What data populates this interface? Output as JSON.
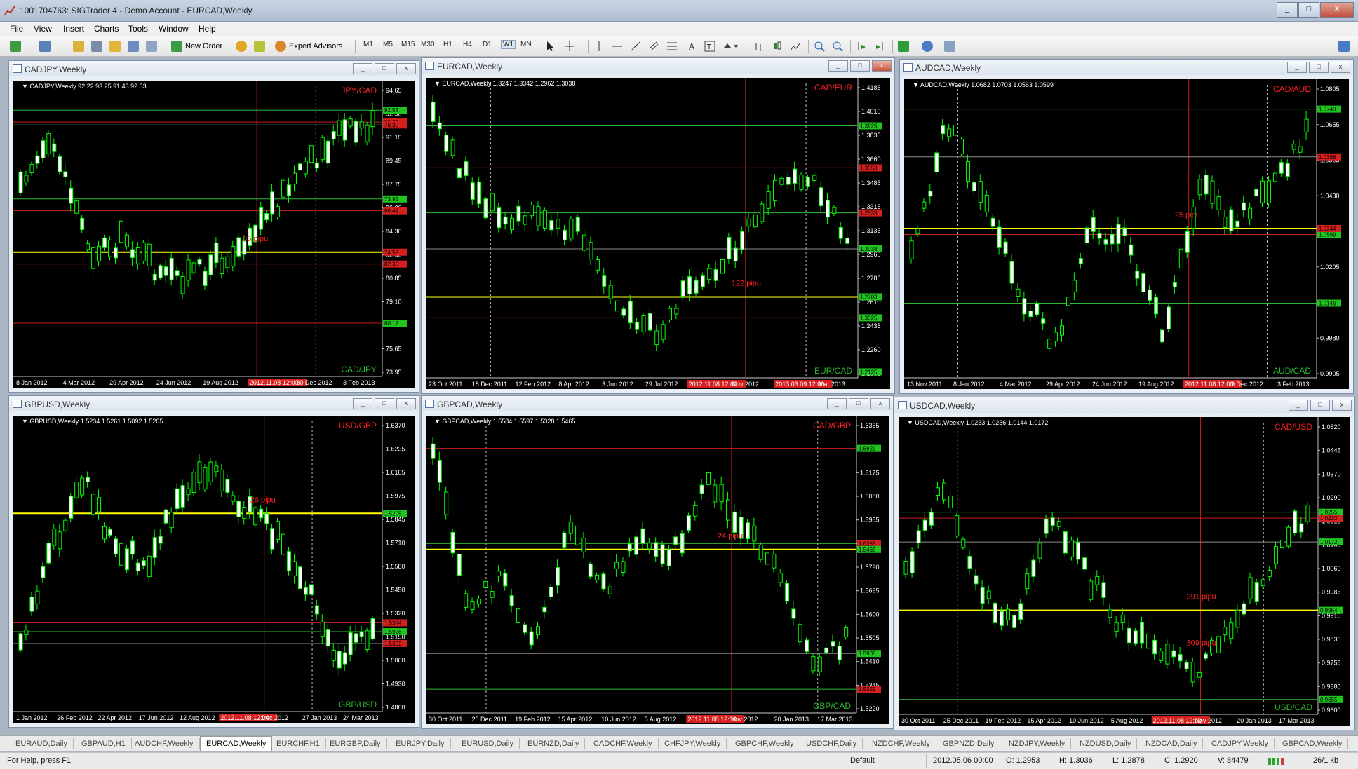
{
  "window": {
    "title": "1001704763: SIGTrader 4 - Demo Account - EURCAD,Weekly",
    "min": "_",
    "max": "□",
    "close": "X"
  },
  "menu": [
    "File",
    "View",
    "Insert",
    "Charts",
    "Tools",
    "Window",
    "Help"
  ],
  "toolbar": {
    "new_order": "New Order",
    "expert_advisors": "Expert Advisors",
    "timeframes": [
      "M1",
      "M5",
      "M15",
      "M30",
      "H1",
      "H4",
      "D1",
      "W1",
      "MN"
    ],
    "active_timeframe": "W1"
  },
  "charts": [
    {
      "window_title": "CADJPY,Weekly",
      "info": "CADJPY,Weekly  92.22 93.25 91.43 92.53",
      "label_top": "JPY/CAD",
      "label_bottom": "CAD/JPY",
      "pips": "35 pipu",
      "y_ticks": [
        "94.65",
        "92.90",
        "91.15",
        "89.45",
        "87.75",
        "86.00",
        "84.30",
        "82.60",
        "80.85",
        "79.10",
        "77.40",
        "75.65",
        "73.95"
      ],
      "x_ticks": [
        "8 Jan 2012",
        "4 Mar 2012",
        "29 Apr 2012",
        "24 Jun 2012",
        "19 Aug 2012",
        "2012.11.08 12:00",
        "30 Dec 2012",
        "3 Feb 2013"
      ],
      "price_tags": [
        "92.53",
        "90.30",
        "86.42",
        "82.30",
        "80.17",
        "78.35",
        "74.52",
        "73.95"
      ]
    },
    {
      "window_title": "EURCAD,Weekly",
      "info": "EURCAD,Weekly  1.3247 1.3342 1.2962 1.3038",
      "label_top": "CAD/EUR",
      "label_bottom": "EUR/CAD",
      "pips": "122 pipu",
      "y_ticks": [
        "1.4185",
        "1.4010",
        "1.3835",
        "1.3660",
        "1.3485",
        "1.3315",
        "1.3135",
        "1.2960",
        "1.2785",
        "1.2610",
        "1.2435",
        "1.2260",
        "1.2085"
      ],
      "x_ticks": [
        "23 Oct 2011",
        "18 Dec 2011",
        "12 Feb 2012",
        "8 Apr 2012",
        "3 Jun 2012",
        "29 Jul 2012",
        "2012.11.08 12:00",
        "Nov 2012",
        "2013.03.09 12:00",
        "Mar 2013"
      ],
      "price_tags": [
        "1.3925",
        "1.3553",
        "1.3325",
        "1.3038",
        "1.2703",
        "1.2533",
        "1.2125"
      ]
    },
    {
      "window_title": "AUDCAD,Weekly",
      "info": "AUDCAD,Weekly  1.0682 1.0703 1.0563 1.0599",
      "label_top": "CAD/AUD",
      "label_bottom": "AUD/CAD",
      "pips": "25 pipu",
      "y_ticks": [
        "1.0805",
        "1.0655",
        "1.0505",
        "1.0430",
        "1.0280",
        "1.0205",
        "1.0055",
        "0.9980",
        "0.9905"
      ],
      "x_ticks": [
        "13 Nov 2011",
        "8 Jan 2012",
        "4 Mar 2012",
        "29 Apr 2012",
        "24 Jun 2012",
        "19 Aug 2012",
        "2012.11.08 12:00",
        "9 Dec 2012",
        "3 Feb 2013"
      ],
      "price_tags": [
        "1.0748",
        "1.0599",
        "1.0368",
        "1.0344",
        "1.0146"
      ]
    },
    {
      "window_title": "GBPUSD,Weekly",
      "info": "GBPUSD,Weekly  1.5234 1.5261 1.5092 1.5205",
      "label_top": "USD/GBP",
      "label_bottom": "GBP/USD",
      "pips": "26 pipu",
      "y_ticks": [
        "1.6370",
        "1.6235",
        "1.6105",
        "1.5975",
        "1.5845",
        "1.5710",
        "1.5580",
        "1.5450",
        "1.5320",
        "1.5190",
        "1.5060",
        "1.4930",
        "1.4800"
      ],
      "x_ticks": [
        "1 Jan 2012",
        "26 Feb 2012",
        "22 Apr 2012",
        "17 Jun 2012",
        "12 Aug 2012",
        "2012.11.08 12:00",
        "Dec 2012",
        "27 Jan 2013",
        "24 Mar 2013"
      ],
      "price_tags": [
        "1.5928",
        "1.5324",
        "1.5302",
        "1.5205"
      ]
    },
    {
      "window_title": "GBPCAD,Weekly",
      "info": "GBPCAD,Weekly  1.5584 1.5597 1.5328 1.5465",
      "label_top": "CAD/GBP",
      "label_bottom": "GBP/CAD",
      "pips": "24 pipu",
      "y_ticks": [
        "1.6365",
        "1.6265",
        "1.6175",
        "1.6080",
        "1.5985",
        "1.5890",
        "1.5790",
        "1.5695",
        "1.5600",
        "1.5505",
        "1.5410",
        "1.5315",
        "1.5220"
      ],
      "x_ticks": [
        "30 Oct 2011",
        "25 Dec 2011",
        "19 Feb 2012",
        "15 Apr 2012",
        "10 Jun 2012",
        "5 Aug 2012",
        "2012.11.08 12:00",
        "Nov 2012",
        "20 Jan 2013",
        "17 Mar 2013"
      ],
      "price_tags": [
        "1.6283",
        "1.5929",
        "1.5905",
        "1.5465",
        "1.5329"
      ]
    },
    {
      "window_title": "USDCAD,Weekly",
      "info": "USDCAD,Weekly  1.0233 1.0236 1.0144 1.0172",
      "label_top": "CAD/USD",
      "label_bottom": "USD/CAD",
      "pips": "291 pipu",
      "pips2": "309 pipu",
      "y_ticks": [
        "1.0520",
        "1.0445",
        "1.0370",
        "1.0290",
        "1.0215",
        "1.0140",
        "1.0060",
        "0.9985",
        "0.9910",
        "0.9830",
        "0.9755",
        "0.9680",
        "0.9600"
      ],
      "x_ticks": [
        "30 Oct 2011",
        "25 Dec 2011",
        "19 Feb 2012",
        "15 Apr 2012",
        "10 Jun 2012",
        "5 Aug 2012",
        "2012.11.08 12:00",
        "Nov 2012",
        "20 Jan 2013",
        "17 Mar 2013"
      ],
      "price_tags": [
        "1.0255",
        "1.0233",
        "1.0172",
        "0.9964",
        "0.9655"
      ]
    }
  ],
  "tabs": [
    "EURAUD,Daily",
    "GBPAUD,H1",
    "AUDCHF,Weekly",
    "EURCAD,Weekly",
    "EURCHF,H1",
    "EURGBP,Daily",
    "EURJPY,Daily",
    "EURUSD,Daily",
    "EURNZD,Daily",
    "CADCHF,Weekly",
    "CHFJPY,Weekly",
    "GBPCHF,Weekly",
    "USDCHF,Daily",
    "NZDCHF,Weekly",
    "GBPNZD,Daily",
    "NZDJPY,Weekly",
    "NZDUSD,Daily",
    "NZDCAD,Daily",
    "CADJPY,Weekly",
    "GBPCAD,Weekly"
  ],
  "active_tab": "EURCAD,Weekly",
  "status": {
    "help": "For Help, press F1",
    "profile": "Default",
    "time": "2012.05.06 00:00",
    "open": "O: 1.2953",
    "high": "H: 1.3036",
    "low": "L: 1.2878",
    "close": "C: 1.2920",
    "volume": "V: 84479",
    "traffic": "26/1 kb"
  },
  "colors": {
    "bull": "#00ff00",
    "bear": "#00ff00",
    "red_line": "#c81e1e",
    "green_line": "#2eb82e",
    "yellow_line": "#ffff00",
    "label_red": "#ff2020"
  }
}
